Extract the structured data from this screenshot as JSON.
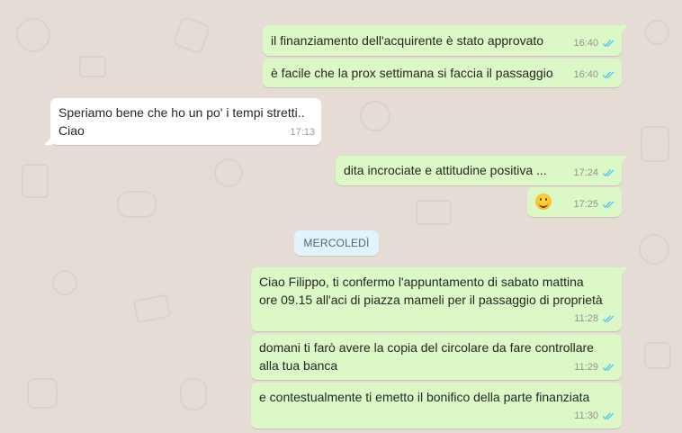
{
  "chat": {
    "messages": [
      {
        "lines": [
          "il finanziamento dell'acquirente è stato approvato"
        ],
        "time": "16:40",
        "direction": "outgoing",
        "status": "read"
      },
      {
        "lines": [
          "è facile che la prox settimana si faccia il passaggio"
        ],
        "time": "16:40",
        "direction": "outgoing",
        "status": "read"
      },
      {
        "lines": [
          "Speriamo bene che ho un po' i tempi stretti..",
          "Ciao"
        ],
        "time": "17:13",
        "direction": "incoming"
      },
      {
        "lines": [
          "dita incrociate e attitudine positiva ..."
        ],
        "time": "17:24",
        "direction": "outgoing",
        "status": "read"
      },
      {
        "emoji": "smiling-face",
        "time": "17:25",
        "direction": "outgoing",
        "status": "read"
      },
      {
        "lines": [
          "Ciao Filippo, ti confermo l'appuntamento di sabato mattina",
          "ore 09.15 all'aci di piazza mameli per il passaggio di proprietà"
        ],
        "time": "11:28",
        "direction": "outgoing",
        "status": "read"
      },
      {
        "lines": [
          "domani ti farò avere la copia del circolare da fare controllare",
          "alla tua banca"
        ],
        "time": "11:29",
        "direction": "outgoing",
        "status": "read"
      },
      {
        "lines": [
          "e contestualmente ti emetto il bonifico della parte finanziata"
        ],
        "time": "11:30",
        "direction": "outgoing",
        "status": "read"
      }
    ],
    "date_separator": "MERCOLEDÌ"
  },
  "colors": {
    "background": "#e5ddd5",
    "outgoing_bubble": "#dcf8c6",
    "incoming_bubble": "#ffffff",
    "read_ticks": "#4fc3f7",
    "date_chip": "#e1f3fb"
  },
  "icons": {
    "read_receipt": "double-check-icon",
    "emoji": "smiling-face-emoji"
  }
}
